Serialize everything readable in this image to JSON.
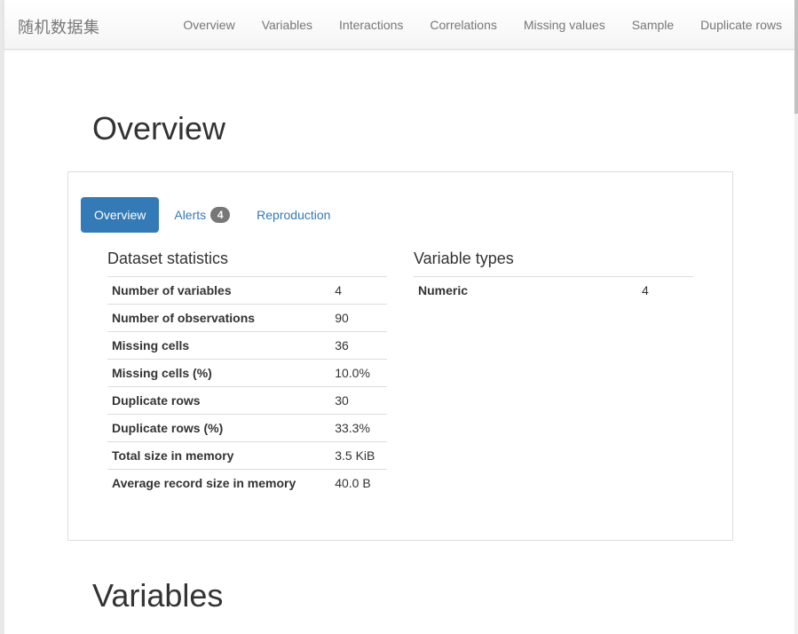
{
  "navbar": {
    "brand": "随机数据集",
    "links": [
      "Overview",
      "Variables",
      "Interactions",
      "Correlations",
      "Missing values",
      "Sample",
      "Duplicate rows"
    ]
  },
  "overview": {
    "title": "Overview",
    "tabs": {
      "overview": "Overview",
      "alerts": "Alerts",
      "alerts_count": "4",
      "reproduction": "Reproduction"
    },
    "dataset_statistics": {
      "heading": "Dataset statistics",
      "rows": [
        {
          "label": "Number of variables",
          "value": "4"
        },
        {
          "label": "Number of observations",
          "value": "90"
        },
        {
          "label": "Missing cells",
          "value": "36"
        },
        {
          "label": "Missing cells (%)",
          "value": "10.0%"
        },
        {
          "label": "Duplicate rows",
          "value": "30"
        },
        {
          "label": "Duplicate rows (%)",
          "value": "33.3%"
        },
        {
          "label": "Total size in memory",
          "value": "3.5 KiB"
        },
        {
          "label": "Average record size in memory",
          "value": "40.0 B"
        }
      ]
    },
    "variable_types": {
      "heading": "Variable types",
      "rows": [
        {
          "label": "Numeric",
          "value": "4"
        }
      ]
    }
  },
  "variables": {
    "title": "Variables"
  },
  "colors": {
    "accent": "#337ab7",
    "badge": "#777777",
    "nav_text": "#777777"
  }
}
